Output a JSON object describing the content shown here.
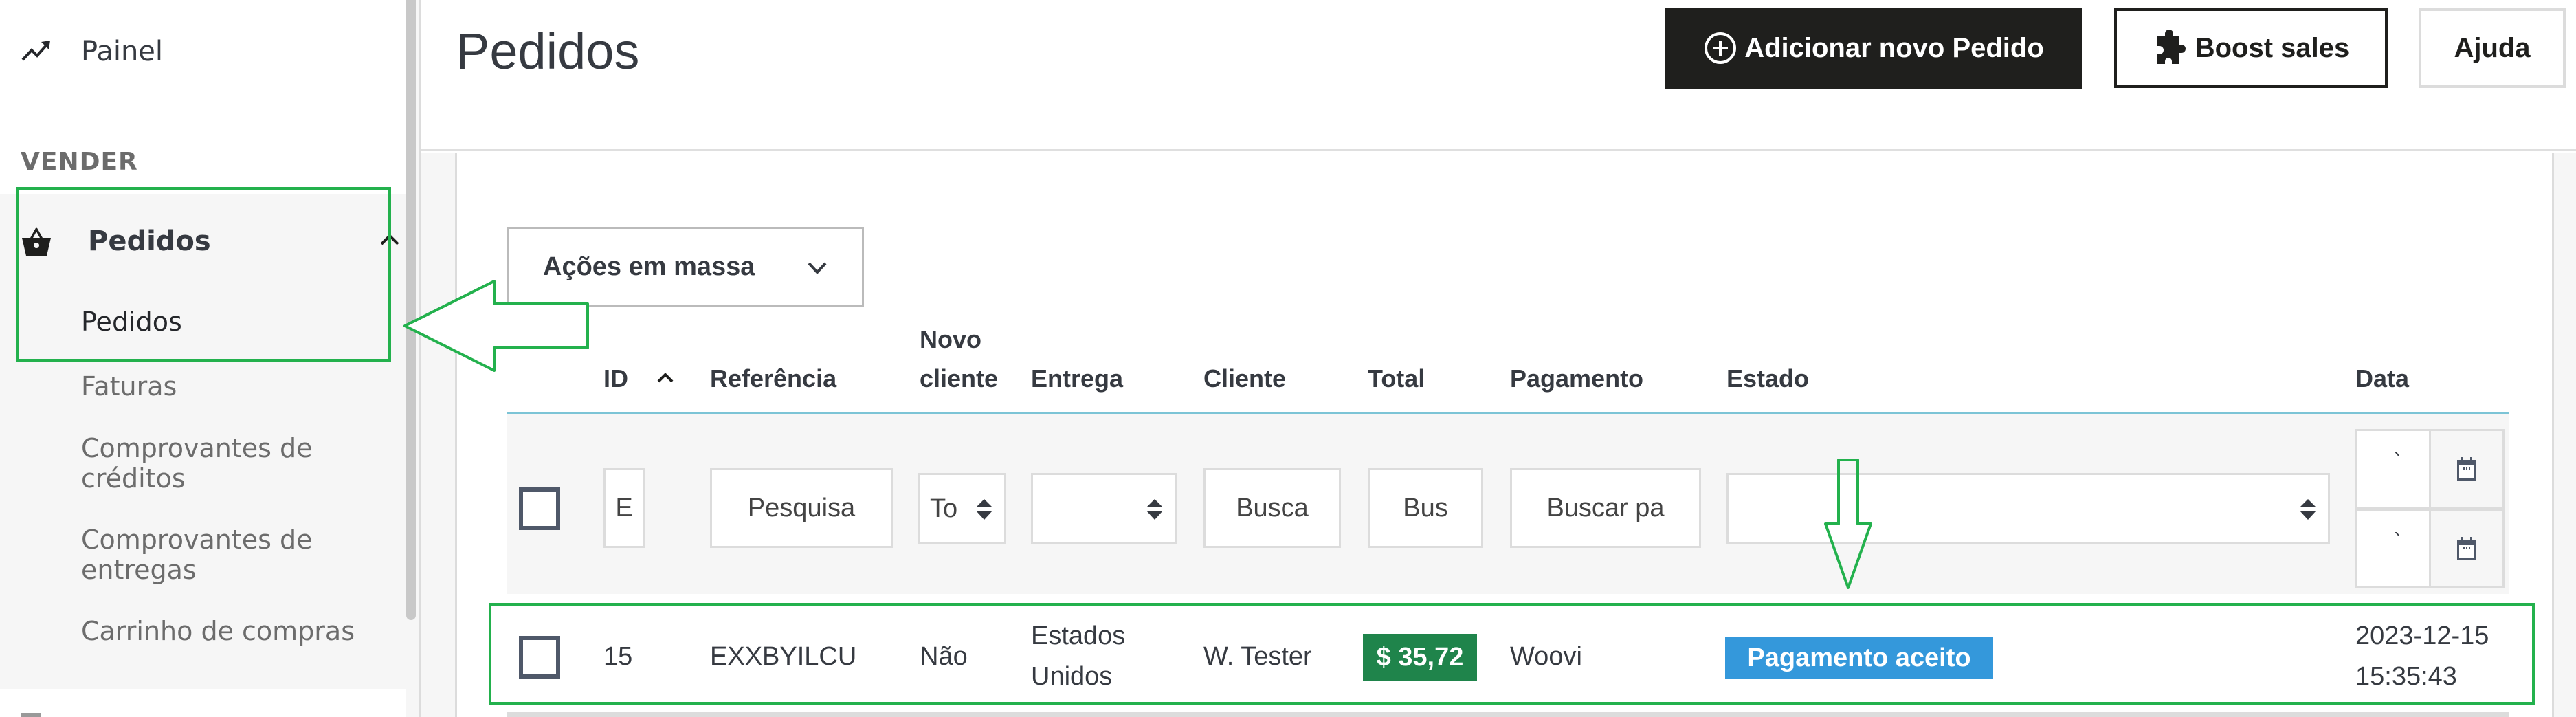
{
  "sidebar": {
    "dashboard_label": "Painel",
    "section_label": "VENDER",
    "orders_parent_label": "Pedidos",
    "sub_items": [
      {
        "label": "Pedidos",
        "active": true
      },
      {
        "label": "Faturas",
        "active": false
      },
      {
        "label": "Comprovantes de créditos",
        "active": false
      },
      {
        "label": "Comprovantes de entregas",
        "active": false
      },
      {
        "label": "Carrinho de compras",
        "active": false
      }
    ],
    "icons": {
      "dashboard": "trending-up-icon",
      "orders": "shopping-basket-icon",
      "collapse": "chevron-up-icon"
    }
  },
  "header": {
    "title": "Pedidos",
    "add_order_label": "Adicionar novo Pedido",
    "boost_sales_label": "Boost sales",
    "help_label": "Ajuda"
  },
  "table": {
    "bulk_actions_label": "Ações em massa",
    "columns": {
      "id": "ID",
      "reference": "Referência",
      "new_client_line1": "Novo",
      "new_client_line2": "cliente",
      "delivery": "Entrega",
      "client": "Cliente",
      "total": "Total",
      "payment": "Pagamento",
      "status": "Estado",
      "date": "Data"
    },
    "sort": {
      "column": "ID",
      "direction": "ascending"
    },
    "filters": {
      "id_placeholder": "E",
      "reference_placeholder": "Pesquisa",
      "new_client_value": "To",
      "delivery_value": "",
      "client_placeholder": "Busca",
      "total_placeholder": "Bus",
      "payment_placeholder": "Buscar pa",
      "status_value": "",
      "date_from": "`",
      "date_to": "`"
    },
    "rows": [
      {
        "id": "15",
        "reference": "EXXBYILCU",
        "new_client": "Não",
        "delivery_line1": "Estados",
        "delivery_line2": "Unidos",
        "client": "W. Tester",
        "total": "$ 35,72",
        "payment": "Woovi",
        "status": "Pagamento aceito",
        "date_line1": "2023-12-15",
        "date_line2": "15:35:43"
      }
    ]
  },
  "colors": {
    "primary_button": "#1f1f1d",
    "total_badge": "#1f844b",
    "status_badge": "#3498db",
    "header_rule": "#7cc4d6",
    "annotation": "#23b14d"
  }
}
